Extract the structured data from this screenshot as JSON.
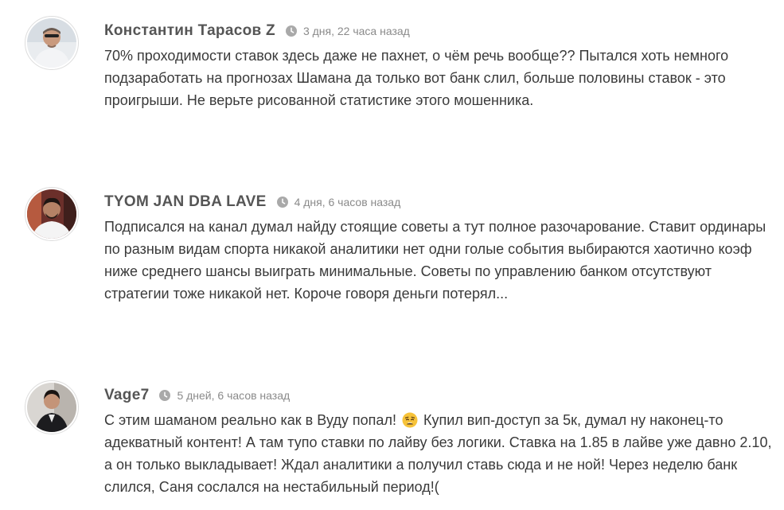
{
  "comments": [
    {
      "author": "Константин Тарасов Z",
      "time": "3 дня, 22 часа назад",
      "lines": [
        "70% проходимости ставок здесь даже не пахнет, о чём речь вообще?? Пытался хоть немного",
        "подзаработать на прогнозах Шамана да только вот банк слил, больше половины ставок - это",
        "проигрыши. Не верьте рисованной статистике этого мошенника."
      ]
    },
    {
      "author": "TYOM JAN DBA LAVE",
      "time": "4 дня, 6 часов назад",
      "lines": [
        "Подписался на канал думал найду стоящие советы а тут полное разочарование. Ставит ординары",
        "по разным видам спорта никакой аналитики нет одни голые события выбираются хаотично коэф",
        "ниже среднего шансы выиграть минимальные. Советы по управлению банком отсутствуют",
        "стратегии тоже никакой нет. Короче говоря деньги потерял..."
      ]
    },
    {
      "author": "Vage7",
      "time": "5 дней, 6 часов назад",
      "line1_before_emoji": "С этим шаманом реально как в Вуду попал!",
      "line1_after_emoji": "Купил вип-доступ за 5к, думал ну наконец-то",
      "emoji": "weary-face-emoji",
      "lines": [
        "адекватный контент! А там тупо ставки по лайву без логики. Ставка на 1.85 в лайве уже давно 2.10,",
        "а он только выкладывает! Ждал аналитики а получил ставь сюда и не ной! Через неделю банк",
        "слился, Саня сослался на нестабильный период!("
      ]
    }
  ],
  "icons": {
    "time": "clock-icon",
    "avatar": "avatar-photo"
  },
  "colors": {
    "author": "#555555",
    "time": "#8a8a8a",
    "text": "#3a3a3a",
    "avatar_border": "#dddddd"
  }
}
